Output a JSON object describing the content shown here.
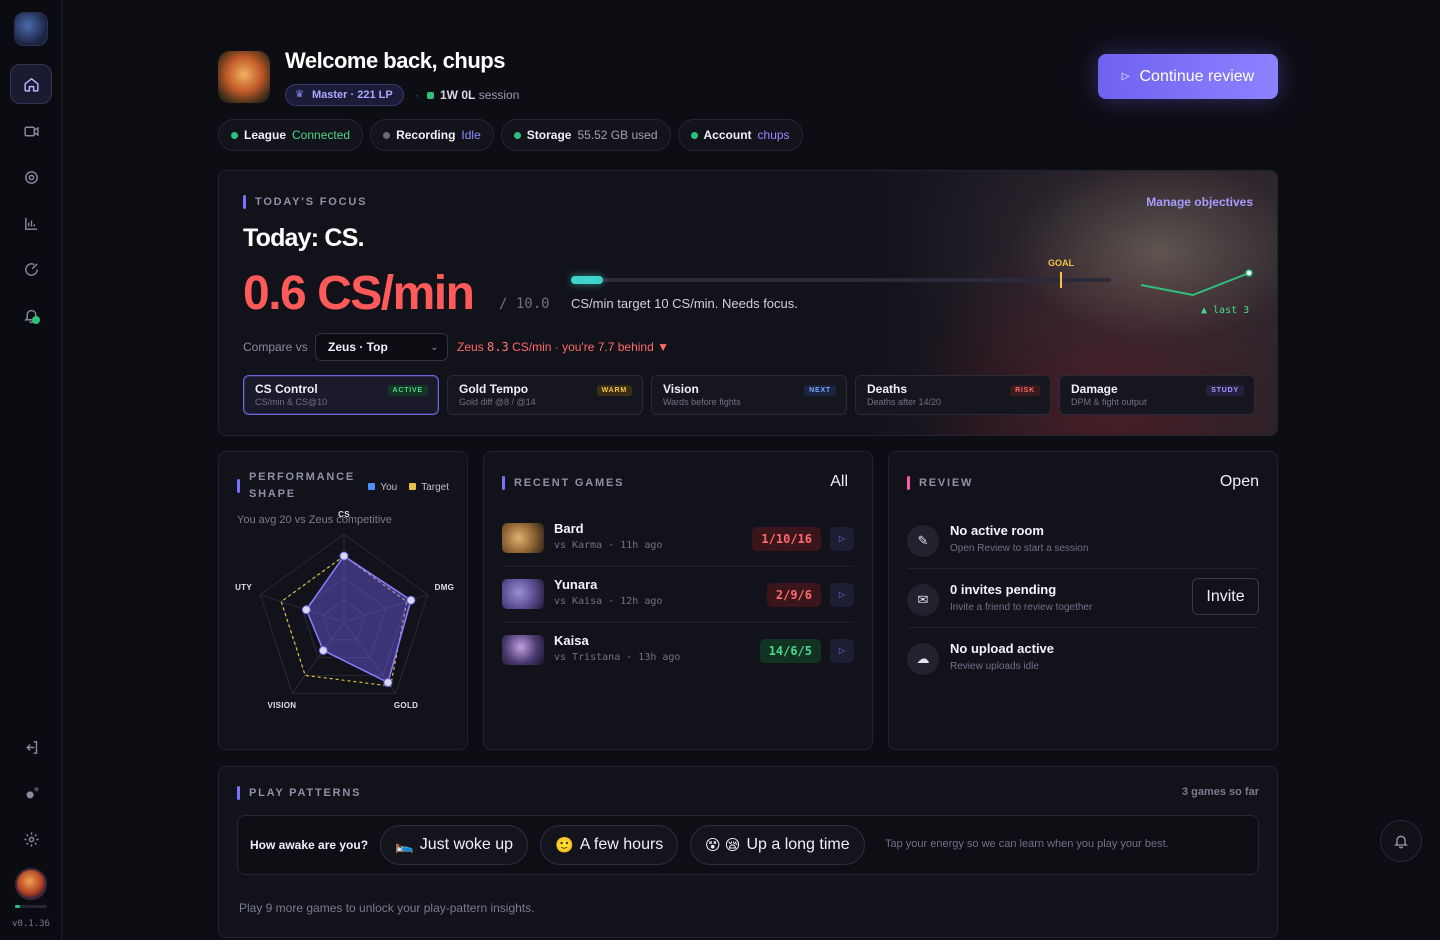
{
  "app": {
    "version": "v0.1.36"
  },
  "header": {
    "title": "Welcome back, chups",
    "rank": "Master · 221 LP",
    "session_record": "1W 0L",
    "session_suffix": "session",
    "cta_label": "Continue review"
  },
  "status": [
    {
      "label": "League",
      "value": "Connected",
      "dot": "#2ec27e",
      "color": "#4cd68a"
    },
    {
      "label": "Recording",
      "value": "Idle",
      "dot": "#6a6a80",
      "color": "#8c8cff"
    },
    {
      "label": "Storage",
      "value": "55.52 GB used",
      "dot": "#2ec27e",
      "color": "#a0a0b4"
    },
    {
      "label": "Account",
      "value": "chups",
      "dot": "#2ec27e",
      "color": "#9a8cff"
    }
  ],
  "focus": {
    "section": "TODAY'S FOCUS",
    "headline": "Today: CS.",
    "value": "0.6 CS/min",
    "target_suffix": "/ 10.0",
    "progress_fraction": 0.06,
    "goal_label": "GOAL",
    "note": "CS/min target 10 CS/min. Needs focus.",
    "manage": "Manage objectives",
    "trend_label": "▲ last 3",
    "compare_label": "Compare vs",
    "compare_value": "Zeus · Top",
    "compare_name": "Zeus",
    "compare_num": "8.3",
    "compare_rest": "CS/min · you're 7.7 behind ▼",
    "objectives": [
      {
        "title": "CS Control",
        "sub": "CS/min & CS@10",
        "tag": "ACTIVE",
        "tag_color": "#4cd68a",
        "tag_bg": "#143424",
        "selected": true
      },
      {
        "title": "Gold Tempo",
        "sub": "Gold diff @8 / @14",
        "tag": "WARM",
        "tag_color": "#f3c24a",
        "tag_bg": "#3a2e14",
        "selected": false
      },
      {
        "title": "Vision",
        "sub": "Wards before fights",
        "tag": "NEXT",
        "tag_color": "#7aa8ff",
        "tag_bg": "#1a2440",
        "selected": false
      },
      {
        "title": "Deaths",
        "sub": "Deaths after 14/20",
        "tag": "RISK",
        "tag_color": "#ff6a6a",
        "tag_bg": "#3a1a1e",
        "selected": false
      },
      {
        "title": "Damage",
        "sub": "DPM & fight output",
        "tag": "STUDY",
        "tag_color": "#a89cff",
        "tag_bg": "#262040",
        "selected": false
      }
    ]
  },
  "performance": {
    "section_line1": "PERFORMANCE",
    "section_line2": "SHAPE",
    "legend_you": "You",
    "legend_target": "Target",
    "subtitle": "You avg 20 vs Zeus competitive",
    "axes": [
      "CS",
      "DMG",
      "GOLD",
      "VISION",
      "UTY"
    ],
    "you": [
      0.75,
      0.8,
      0.85,
      0.4,
      0.45
    ],
    "target": [
      0.75,
      0.75,
      0.9,
      0.75,
      0.75
    ],
    "you_color": "#6e62e8",
    "target_color": "#e6c24a"
  },
  "recent_games": {
    "section": "RECENT GAMES",
    "filter": "All",
    "games": [
      {
        "champion": "Bard",
        "opponent": "vs Karma",
        "when": "11h ago",
        "kda": "1/10/16",
        "result": "loss"
      },
      {
        "champion": "Yunara",
        "opponent": "vs Kaisa",
        "when": "12h ago",
        "kda": "2/9/6",
        "result": "loss"
      },
      {
        "champion": "Kaisa",
        "opponent": "vs Tristana",
        "when": "13h ago",
        "kda": "14/6/5",
        "result": "win"
      }
    ]
  },
  "review": {
    "section": "REVIEW",
    "open_label": "Open",
    "items": [
      {
        "title": "No active room",
        "sub": "Open Review to start a session",
        "icon": "pin-icon"
      },
      {
        "title": "0 invites pending",
        "sub": "Invite a friend to review together",
        "icon": "envelope-icon"
      },
      {
        "title": "No upload active",
        "sub": "Review uploads idle",
        "icon": "cloud-icon"
      }
    ],
    "invite_label": "Invite"
  },
  "patterns": {
    "section": "PLAY PATTERNS",
    "games_note": "3 games so far",
    "question": "How awake are you?",
    "options": [
      {
        "emoji": "🛌",
        "label": "Just woke up"
      },
      {
        "emoji": "🙂",
        "label": "A few hours"
      },
      {
        "emoji": "😵 😪",
        "label": "Up a long time"
      }
    ],
    "hint": "Tap your energy so we can learn when you play your best.",
    "unlock": "Play 9 more games to unlock your play-pattern insights."
  },
  "colors": {
    "accent": "#7a72ff",
    "danger": "#ff5a5a",
    "success": "#2ec27e",
    "goal": "#f3c24a",
    "teal": "#3fd5c8"
  }
}
